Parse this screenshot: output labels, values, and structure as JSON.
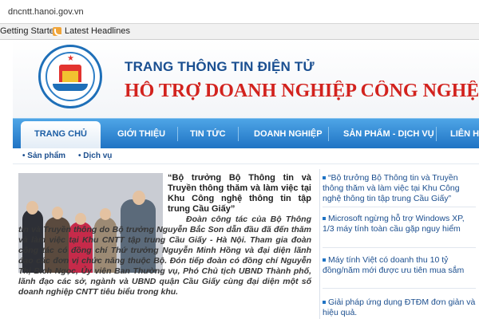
{
  "browser": {
    "url": "dncntt.hanoi.gov.vn",
    "bookmarks": [
      "Getting Started",
      "Latest Headlines"
    ]
  },
  "header": {
    "title_small": "TRANG THÔNG TIN ĐIỆN TỬ",
    "title_big": "HỖ TRỢ DOANH NGHIỆP CÔNG NGHỆ"
  },
  "nav": {
    "items": [
      "TRANG CHỦ",
      "GIỚI THIỆU",
      "TIN TỨC",
      "DOANH NGHIỆP",
      "SẢN PHẨM - DỊCH VỤ",
      "LIÊN HỆ"
    ],
    "active": "TRANG CHỦ"
  },
  "subnav": {
    "items": [
      "Sản phẩm",
      "Dịch vụ"
    ]
  },
  "article": {
    "headline": "“Bộ trưởng Bộ Thông tin và Truyền thông thăm và làm việc tại Khu Công nghệ thông tin tập trung Cầu Giấy”",
    "body": "Đoàn công tác của Bộ Thông tin và Truyền thông do Bộ trưởng Nguyễn Bắc Son dẫn đầu đã đến thăm và làm việc tại Khu CNTT tập trung Cầu Giấy - Hà Nội. Tham gia đoàn công tác có đồng chí Thứ trưởng Nguyễn Minh Hồng và đại diện lãnh đạo các đơn vị chức năng thuộc Bộ. Đón tiếp đoàn có đồng chí Nguyễn Thị Bích Ngọc, Ủy viên Ban Thường vụ, Phó Chủ tịch UBND Thành phố, lãnh đạo các sở, ngành và UBND quận Cầu Giấy cùng đại diện một số doanh nghiệp CNTT tiêu biểu trong khu."
  },
  "sidebar": {
    "items": [
      "“Bộ trưởng Bộ Thông tin và Truyền thông thăm và làm việc tại Khu Công nghệ thông tin tập trung Cầu Giấy”",
      "Microsoft ngừng hỗ trợ Windows XP, 1/3 máy tính toàn cầu gặp nguy hiểm",
      "Máy tính Việt có doanh thu 10 tỷ đồng/năm mới được ưu tiên mua sắm",
      "Giải pháp ứng dụng ĐTĐM đơn giản và hiệu quả."
    ]
  },
  "colors": {
    "nav_blue": "#1f73c4",
    "title_red": "#d2231e",
    "title_blue": "#1a4f91"
  }
}
